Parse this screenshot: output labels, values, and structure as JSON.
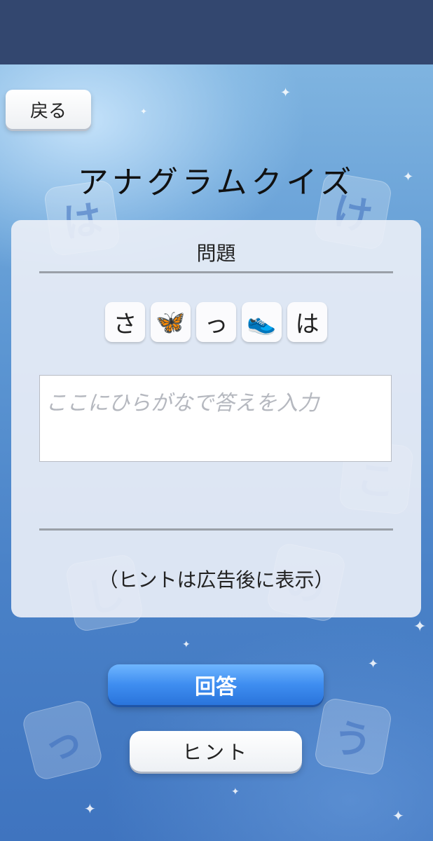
{
  "nav": {
    "back_label": "戻る"
  },
  "page": {
    "title": "アナグラムクイズ"
  },
  "question": {
    "heading": "問題",
    "tiles": [
      {
        "kind": "text",
        "value": "さ"
      },
      {
        "kind": "icon",
        "icon": "butterfly-icon",
        "glyph": "🦋"
      },
      {
        "kind": "text",
        "value": "っ"
      },
      {
        "kind": "icon",
        "icon": "sneaker-icon",
        "glyph": "👟"
      },
      {
        "kind": "text",
        "value": "は"
      }
    ]
  },
  "answer": {
    "placeholder": "ここにひらがなで答えを入力",
    "value": ""
  },
  "hint": {
    "text": "（ヒントは広告後に表示）"
  },
  "buttons": {
    "answer_label": "回答",
    "hint_label": "ヒント"
  },
  "colors": {
    "accent": "#3e8df0",
    "topbar": "#33476f"
  }
}
